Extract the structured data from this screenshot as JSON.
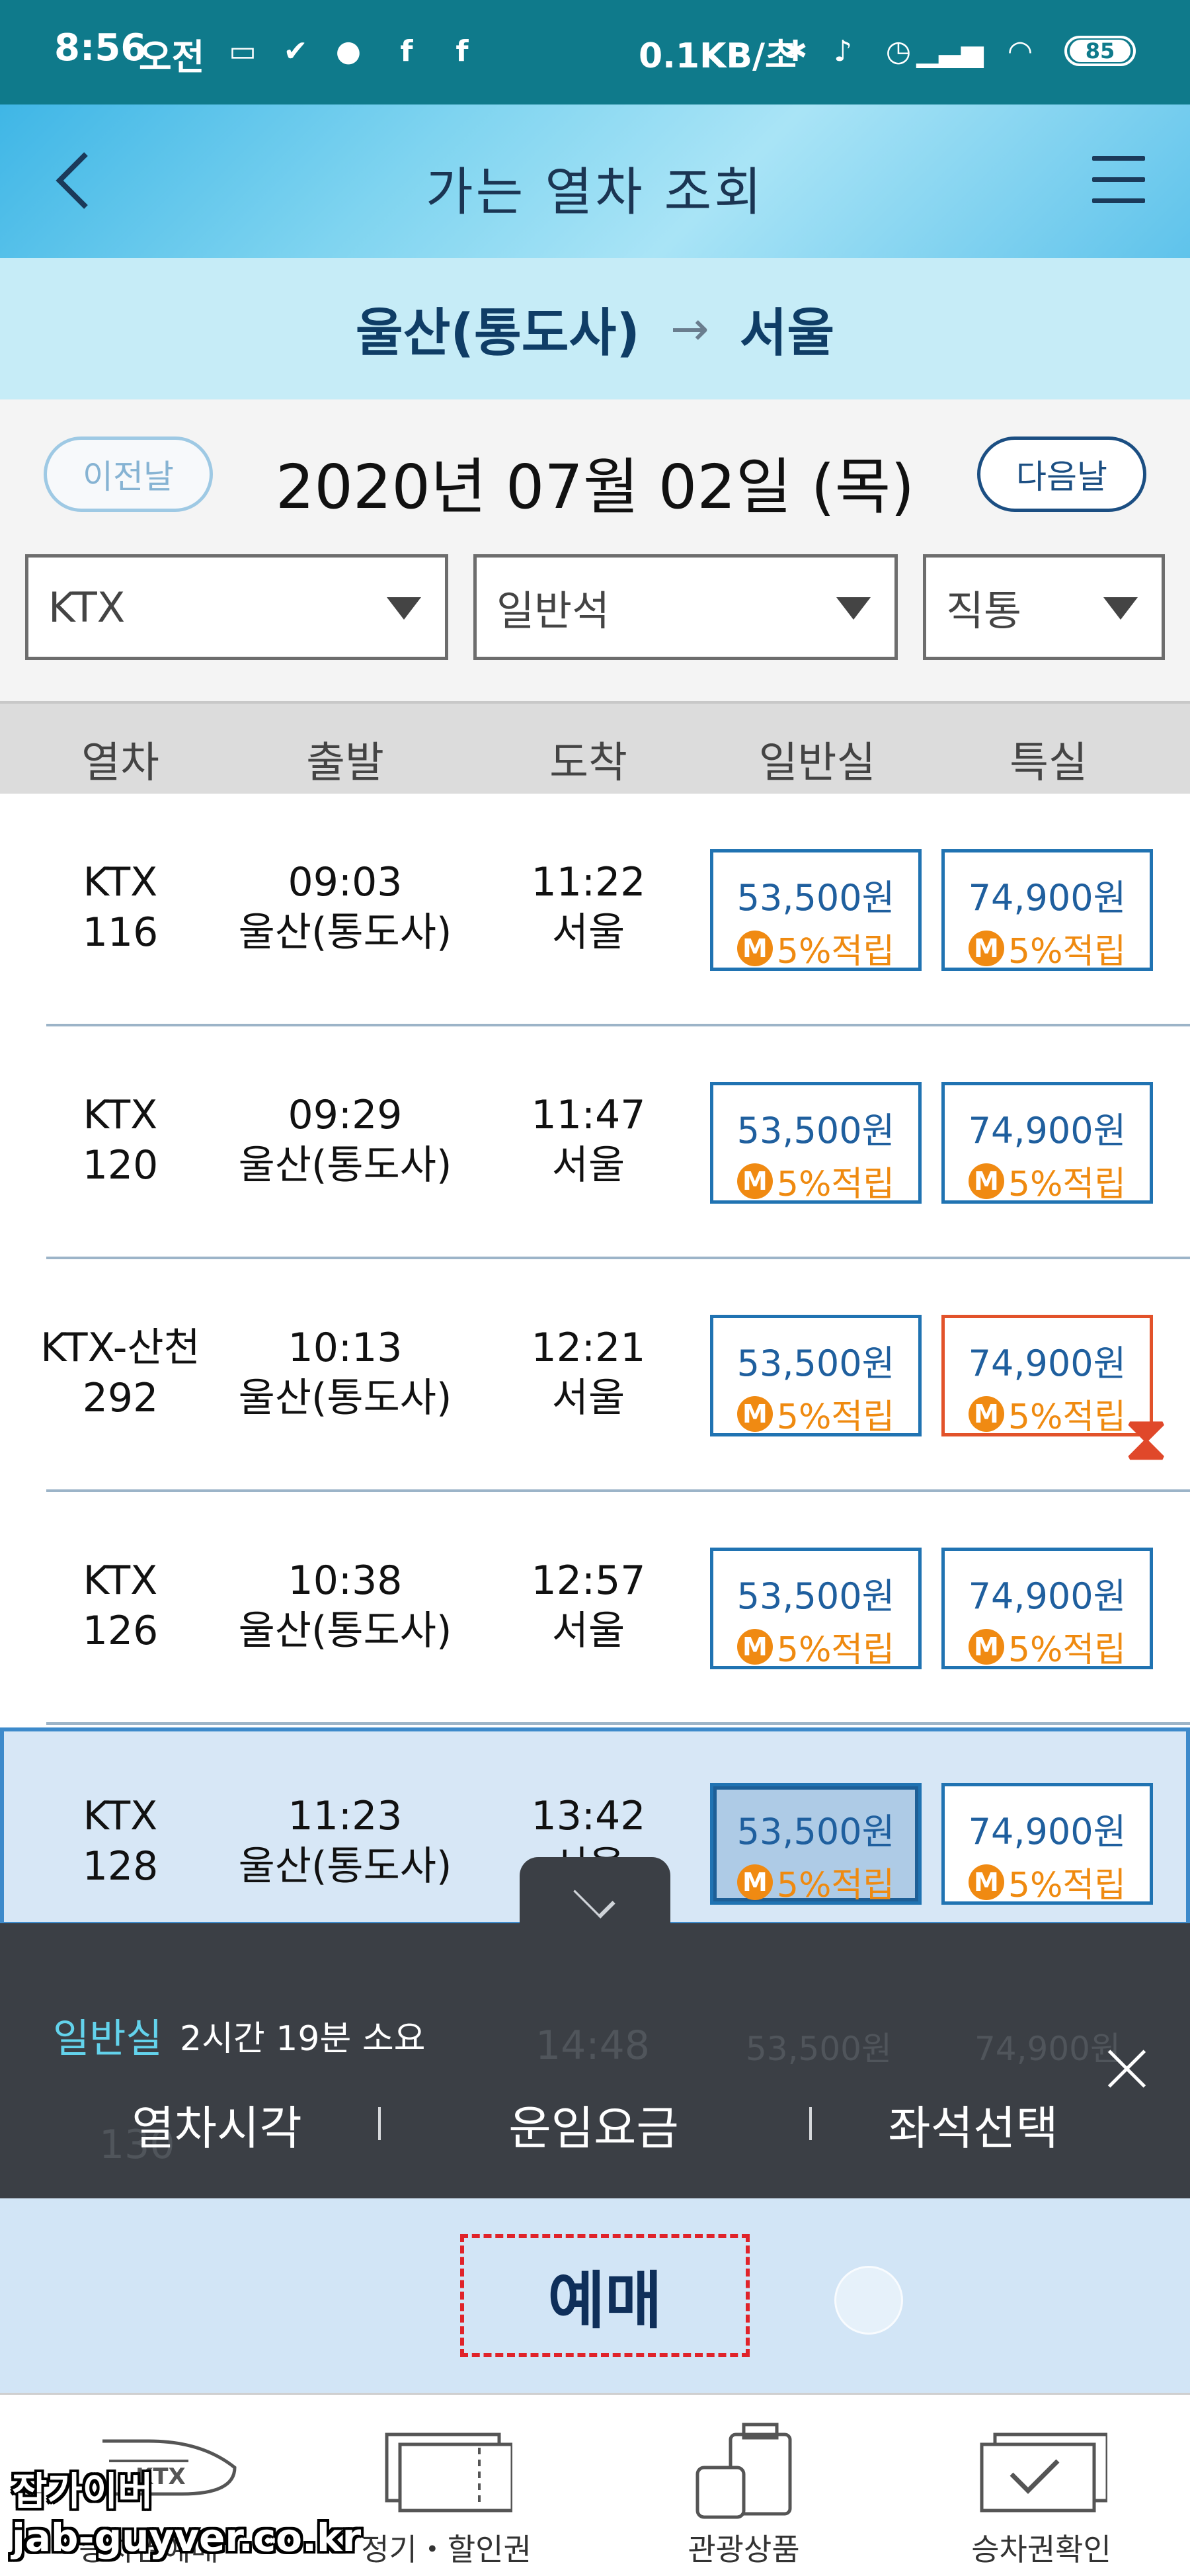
{
  "status_bar": {
    "time": "8:56",
    "ampm": "오전",
    "net_speed": "0.1KB/초",
    "battery": "85"
  },
  "header": {
    "title": "가는 열차 조회"
  },
  "route": {
    "from": "울산(통도사)",
    "to": "서울"
  },
  "date_bar": {
    "prev_label": "이전날",
    "date": "2020년 07월 02일 (목)",
    "next_label": "다음날"
  },
  "filters": {
    "train_type": "KTX",
    "seat_class": "일반석",
    "route_type": "직통"
  },
  "columns": {
    "train": "열차",
    "departure": "출발",
    "arrival": "도착",
    "economy": "일반실",
    "first": "특실"
  },
  "trains": [
    {
      "name": "KTX",
      "number": "116",
      "dep_time": "09:03",
      "dep_station": "울산(통도사)",
      "arr_time": "11:22",
      "arr_station": "서울",
      "economy_fare": "53,500원",
      "economy_point": "5%적립",
      "first_fare": "74,900원",
      "first_point": "5%적립"
    },
    {
      "name": "KTX",
      "number": "120",
      "dep_time": "09:29",
      "dep_station": "울산(통도사)",
      "arr_time": "11:47",
      "arr_station": "서울",
      "economy_fare": "53,500원",
      "economy_point": "5%적립",
      "first_fare": "74,900원",
      "first_point": "5%적립"
    },
    {
      "name": "KTX-산천",
      "number": "292",
      "dep_time": "10:13",
      "dep_station": "울산(통도사)",
      "arr_time": "12:21",
      "arr_station": "서울",
      "economy_fare": "53,500원",
      "economy_point": "5%적립",
      "first_fare": "74,900원",
      "first_point": "5%적립"
    },
    {
      "name": "KTX",
      "number": "126",
      "dep_time": "10:38",
      "dep_station": "울산(통도사)",
      "arr_time": "12:57",
      "arr_station": "서울",
      "economy_fare": "53,500원",
      "economy_point": "5%적립",
      "first_fare": "74,900원",
      "first_point": "5%적립"
    },
    {
      "name": "KTX",
      "number": "128",
      "dep_time": "11:23",
      "dep_station": "울산(통도사)",
      "arr_time": "13:42",
      "arr_station": "서울",
      "economy_fare": "53,500원",
      "economy_point": "5%적립",
      "first_fare": "74,900원",
      "first_point": "5%적립"
    }
  ],
  "point_badge": "M",
  "ghost_row": {
    "number": "130",
    "arr_time": "14:48",
    "fare1": "53,500원",
    "fare2": "74,900원"
  },
  "selection_panel": {
    "seat_type": "일반실",
    "duration": "2시간 19분 소요",
    "tab_time": "열차시각",
    "tab_fare": "운임요금",
    "tab_seat": "좌석선택",
    "sep": "|"
  },
  "reserve_button": "예매",
  "bottom_nav": [
    {
      "label": "승차권예매",
      "icon": "ktx-train-icon"
    },
    {
      "label": "정기・할인권",
      "icon": "ticket-icon"
    },
    {
      "label": "관광상품",
      "icon": "luggage-icon"
    },
    {
      "label": "승차권확인",
      "icon": "ticket-check-icon"
    }
  ],
  "watermark": {
    "line1": "잡가이버",
    "line2": "jab-guyver.co.kr"
  },
  "colors": {
    "status_bar": "#0f7a8b",
    "route_bg": "#c6ecf7",
    "fare_border": "#2073b2",
    "waitlist_border": "#e2522a",
    "point_orange": "#ef8a10",
    "overlay": "#3b3f45",
    "reserve_bg": "#d2e5f6"
  }
}
